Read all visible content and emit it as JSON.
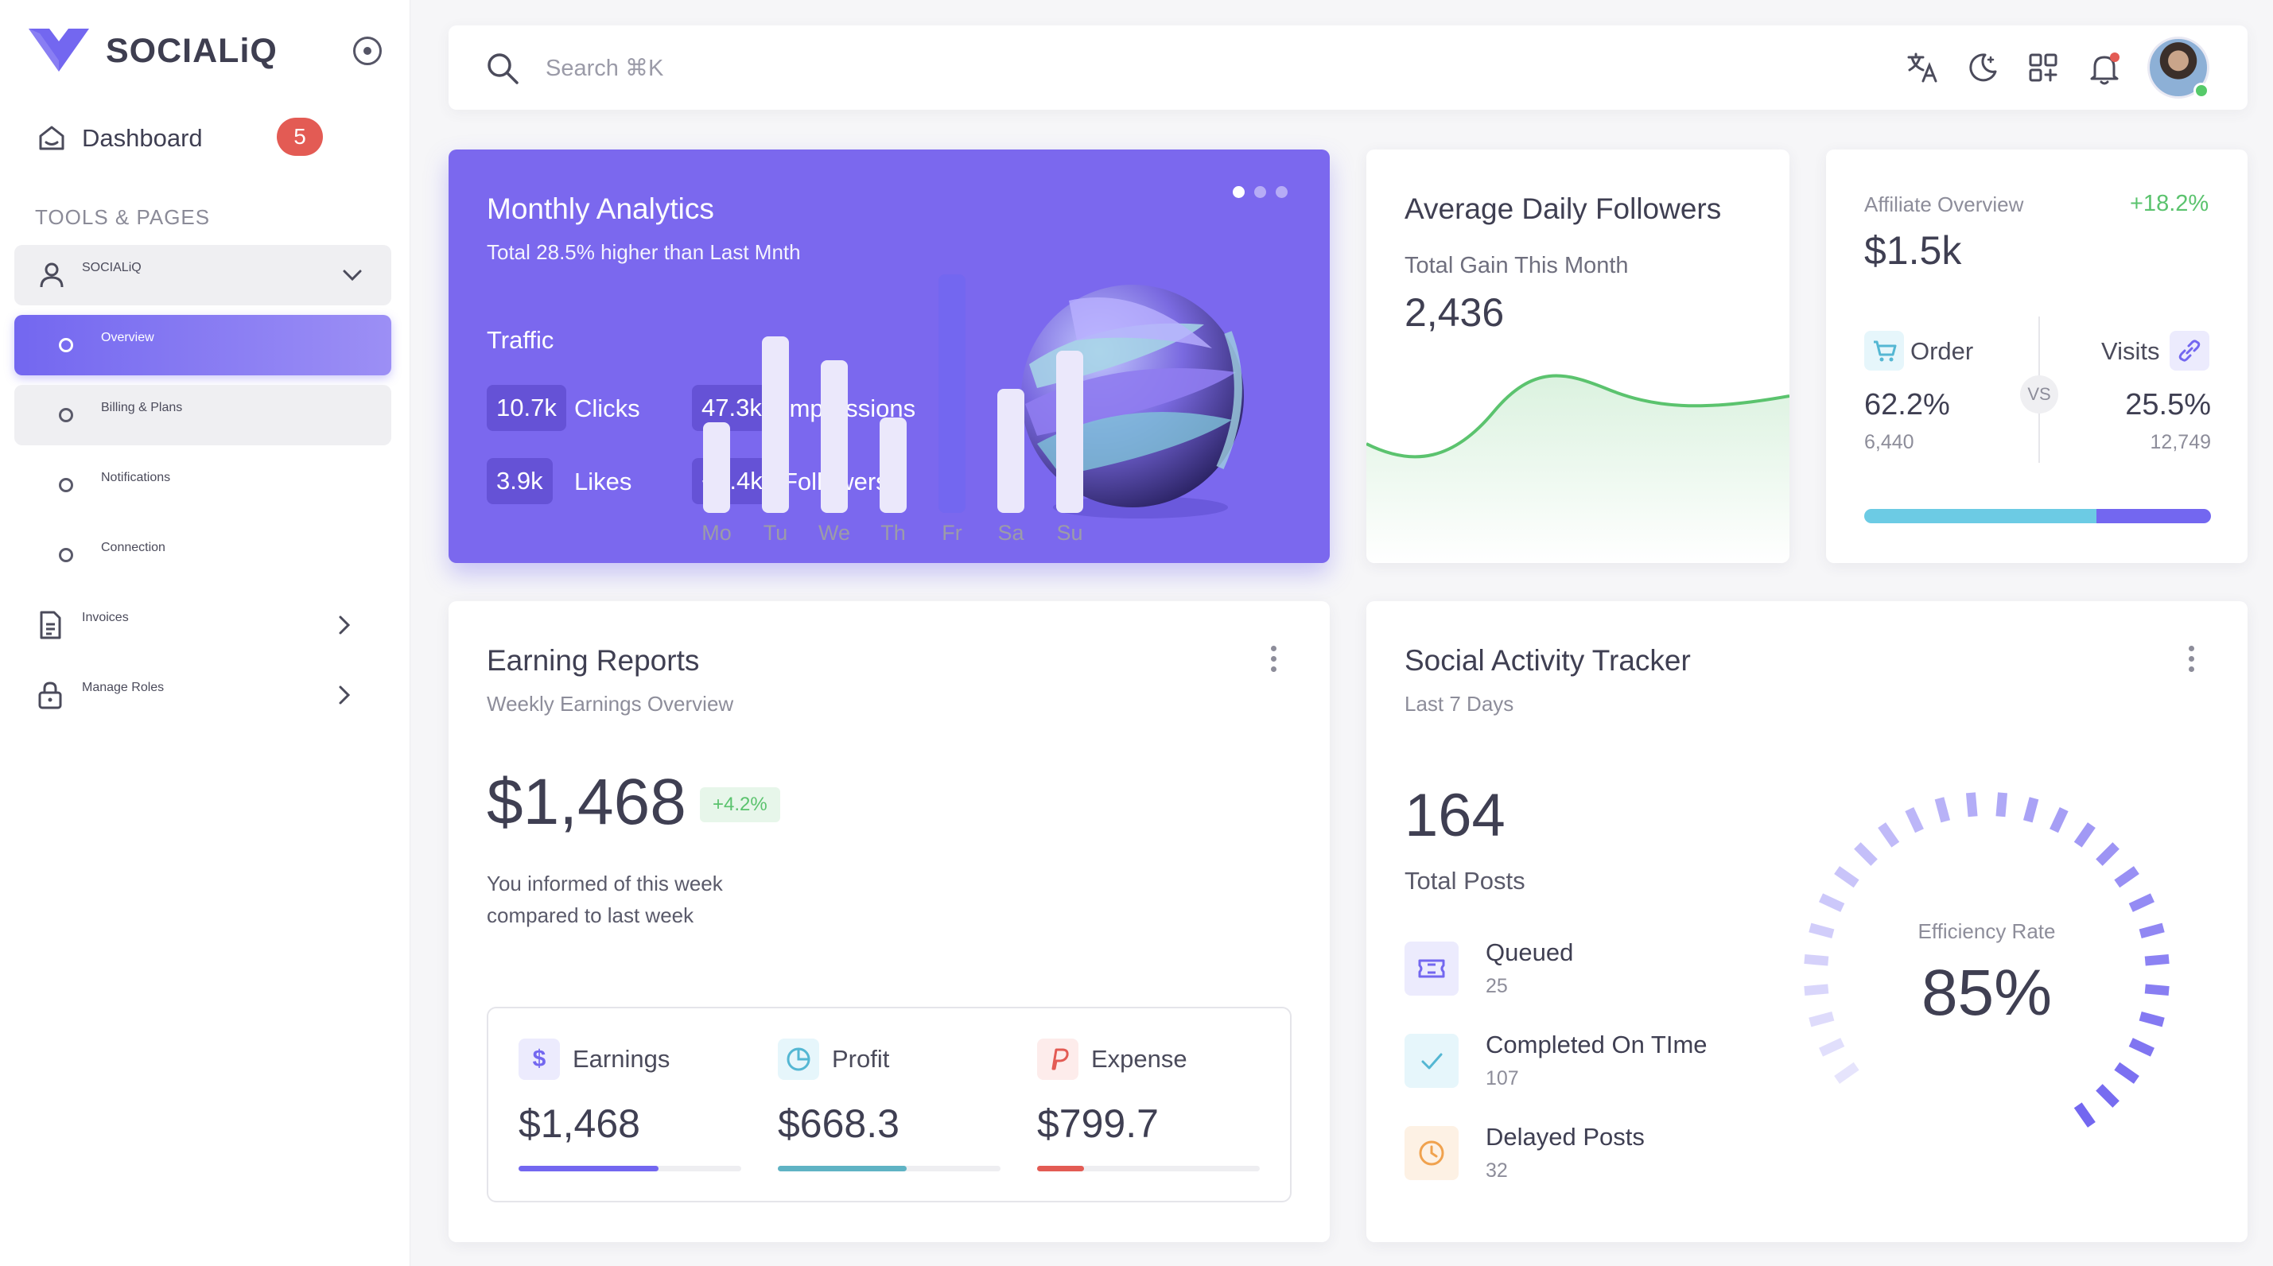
{
  "brand": {
    "name": "SOCIALiQ"
  },
  "sidebar": {
    "dashboard_label": "Dashboard",
    "dashboard_badge": "5",
    "section_title": "TOOLS & PAGES",
    "group_label": "SOCIALiQ",
    "subitems": [
      "Overview",
      "Billing & Plans",
      "Notifications",
      "Connection"
    ],
    "invoices_label": "Invoices",
    "roles_label": "Manage Roles"
  },
  "topbar": {
    "search_placeholder": "Search ⌘K",
    "icons": [
      "translate-icon",
      "moon-icon",
      "apps-icon",
      "bell-icon"
    ]
  },
  "analytics": {
    "title": "Monthly Analytics",
    "subtitle": "Total 28.5% higher than Last Mnth",
    "section": "Traffic",
    "stats": [
      {
        "value": "10.7k",
        "label": "Clicks"
      },
      {
        "value": "47.3k",
        "label": "Impressions"
      },
      {
        "value": "3.9k",
        "label": "Likes"
      },
      {
        "value": "+2.4k",
        "label": "Followers"
      }
    ],
    "active_slide": 1,
    "slides": 3
  },
  "followers": {
    "title": "Average Daily Followers",
    "subtitle": "Total Gain This Month",
    "value": "2,436",
    "accent": "#5bc36e"
  },
  "affiliate": {
    "title": "Affiliate Overview",
    "change": "+18.2%",
    "value": "$1.5k",
    "order_label": "Order",
    "visits_label": "Visits",
    "vs": "VS",
    "order_pct": "62.2%",
    "order_count": "6,440",
    "visits_pct": "25.5%",
    "visits_count": "12,749",
    "order_share": 0.67
  },
  "earning": {
    "title": "Earning Reports",
    "subtitle": "Weekly Earnings Overview",
    "amount": "$1,468",
    "change": "+4.2%",
    "note_line1": "You informed of this week",
    "note_line2": "compared to last week",
    "days": [
      "Mo",
      "Tu",
      "We",
      "Th",
      "Fr",
      "Sa",
      "Su"
    ],
    "bars": [
      38,
      74,
      64,
      40,
      100,
      52,
      68
    ],
    "highlight_index": 4,
    "stats": [
      {
        "label": "Earnings",
        "value": "$1,468",
        "progress": 0.63,
        "color": "#7367f0",
        "icon": "dollar-icon"
      },
      {
        "label": "Profit",
        "value": "$668.3",
        "progress": 0.58,
        "color": "#5fb3c4",
        "icon": "pie-chart-icon"
      },
      {
        "label": "Expense",
        "value": "$799.7",
        "progress": 0.21,
        "color": "#e35b54",
        "icon": "paypal-icon"
      }
    ]
  },
  "social": {
    "title": "Social Activity Tracker",
    "subtitle": "Last 7 Days",
    "total": "164",
    "total_label": "Total Posts",
    "items": [
      {
        "label": "Queued",
        "value": "25",
        "icon": "ticket-icon"
      },
      {
        "label": "Completed On TIme",
        "value": "107",
        "icon": "check-icon"
      },
      {
        "label": "Delayed Posts",
        "value": "32",
        "icon": "clock-icon"
      }
    ],
    "gauge_label": "Efficiency Rate",
    "gauge_value": "85%",
    "gauge_fraction": 0.85
  }
}
